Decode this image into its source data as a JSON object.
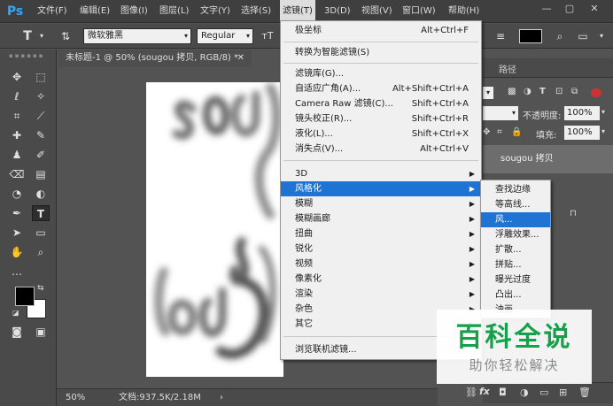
{
  "app": {
    "logo": "Ps"
  },
  "menubar": {
    "items": [
      "文件(F)",
      "编辑(E)",
      "图像(I)",
      "图层(L)",
      "文字(Y)",
      "选择(S)",
      "滤镜(T)",
      "3D(D)",
      "视图(V)",
      "窗口(W)",
      "帮助(H)"
    ]
  },
  "options": {
    "font_family": "微软雅黑",
    "font_style": "Regular",
    "color": "#000000"
  },
  "document": {
    "tab_title": "未标题-1 @ 50% (sougou 拷贝, RGB/8) *",
    "zoom": "50%",
    "doc_info": "文档:937.5K/2.18M"
  },
  "panels": {
    "paths_tab": "路径",
    "opacity_label": "不透明度:",
    "opacity_value": "100%",
    "fill_label": "填充:",
    "fill_value": "100%",
    "layer_name": "sougou 拷贝"
  },
  "filter_menu": {
    "items": [
      {
        "label": "极坐标",
        "shortcut": "Alt+Ctrl+F"
      },
      {
        "label": "转换为智能滤镜(S)",
        "shortcut": ""
      },
      {
        "label": "滤镜库(G)...",
        "shortcut": ""
      },
      {
        "label": "自适应广角(A)...",
        "shortcut": "Alt+Shift+Ctrl+A"
      },
      {
        "label": "Camera Raw 滤镜(C)...",
        "shortcut": "Shift+Ctrl+A"
      },
      {
        "label": "镜头校正(R)...",
        "shortcut": "Shift+Ctrl+R"
      },
      {
        "label": "液化(L)...",
        "shortcut": "Shift+Ctrl+X"
      },
      {
        "label": "消失点(V)...",
        "shortcut": "Alt+Ctrl+V"
      },
      {
        "label": "3D",
        "shortcut": ""
      },
      {
        "label": "风格化",
        "shortcut": ""
      },
      {
        "label": "模糊",
        "shortcut": ""
      },
      {
        "label": "模糊画廊",
        "shortcut": ""
      },
      {
        "label": "扭曲",
        "shortcut": ""
      },
      {
        "label": "锐化",
        "shortcut": ""
      },
      {
        "label": "视频",
        "shortcut": ""
      },
      {
        "label": "像素化",
        "shortcut": ""
      },
      {
        "label": "渲染",
        "shortcut": ""
      },
      {
        "label": "杂色",
        "shortcut": ""
      },
      {
        "label": "其它",
        "shortcut": ""
      },
      {
        "label": "浏览联机滤镜...",
        "shortcut": ""
      }
    ]
  },
  "stylize_submenu": {
    "items": [
      "查找边缘",
      "等高线...",
      "风...",
      "浮雕效果...",
      "扩散...",
      "拼贴...",
      "曝光过度",
      "凸出...",
      "油画..."
    ]
  },
  "watermark": {
    "title": "百科全说",
    "subtitle": "助你轻松解决"
  },
  "colors": {
    "accent": "#1f73d2",
    "menubar_bg": "#3f3f3f",
    "watermark_green": "#16a04a"
  }
}
